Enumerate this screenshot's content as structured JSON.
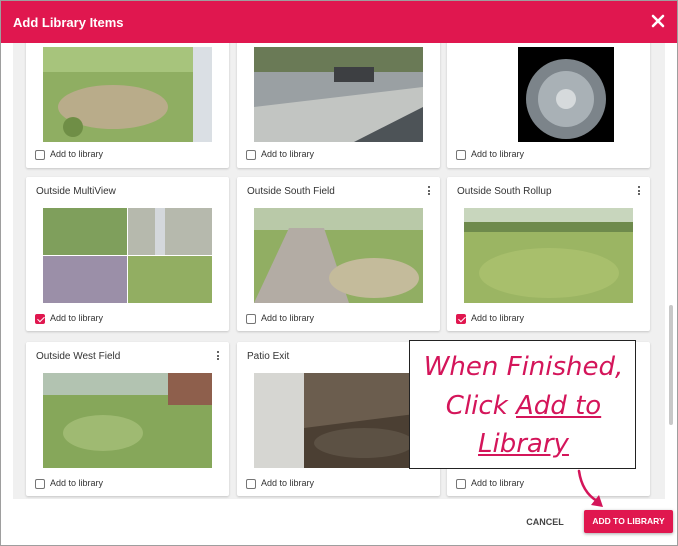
{
  "dialog": {
    "title": "Add Library Items"
  },
  "cards": [
    {
      "title": "",
      "checkbox_label": "Add to library",
      "checked": false
    },
    {
      "title": "",
      "checkbox_label": "Add to library",
      "checked": false
    },
    {
      "title": "",
      "checkbox_label": "Add to library",
      "checked": false
    },
    {
      "title": "Outside MultiView",
      "checkbox_label": "Add to library",
      "checked": true
    },
    {
      "title": "Outside South Field",
      "checkbox_label": "Add to library",
      "checked": false
    },
    {
      "title": "Outside South Rollup",
      "checkbox_label": "Add to library",
      "checked": true
    },
    {
      "title": "Outside West Field",
      "checkbox_label": "Add to library",
      "checked": false
    },
    {
      "title": "Patio Exit",
      "checkbox_label": "Add to library",
      "checked": false
    },
    {
      "title": "",
      "checkbox_label": "Add to library",
      "checked": false
    }
  ],
  "footer": {
    "cancel_label": "CANCEL",
    "add_label": "ADD TO LIBRARY"
  },
  "callout": {
    "line1": "When Finished,",
    "line2_prefix": "Click ",
    "line2_link": "Add to",
    "line3_link": "Library"
  },
  "colors": {
    "brand": "#e0174f",
    "callout_text": "#d4155a"
  }
}
